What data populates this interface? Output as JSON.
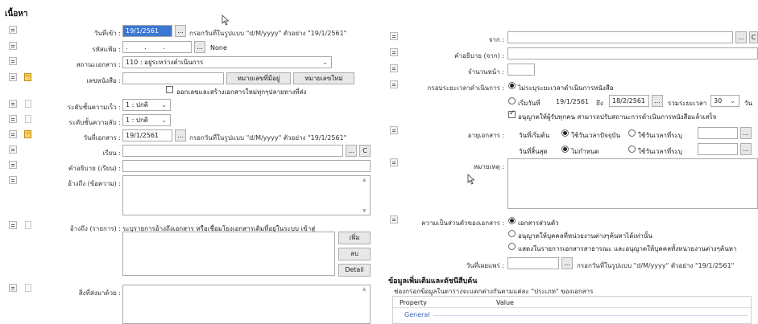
{
  "section_title": "เนื้อหา",
  "left": {
    "date_in": {
      "label": "วันที่เข้า :",
      "value": "19/1/2561",
      "hint": "กรอกวันที่ในรูปแบบ \"d/M/yyyy\" ตัวอย่าง \"19/1/2561\""
    },
    "file_code": {
      "label": "รหัสแฟ้ม :",
      "value": ". . .",
      "none_text": "None"
    },
    "doc_status": {
      "label": "สถานะเอกสาร :",
      "value": "110 : อยู่ระหว่างดำเนินการ"
    },
    "doc_number": {
      "label": "เลขหนังสือ :",
      "value": "",
      "btn_existing": "หมายเลขที่มีอยู่",
      "btn_new": "หมายเลขใหม่",
      "checkbox_label": "ออกเลขและสร้างเอกสารใหม่ทุกๆปลายทางที่ส่ง"
    },
    "urgency": {
      "label": "ระดับชั้นความเร็ว :",
      "value": "1 : ปกติ"
    },
    "secrecy": {
      "label": "ระดับชั้นความลับ :",
      "value": "1 : ปกติ"
    },
    "doc_date": {
      "label": "วันที่เอกสาร :",
      "value": "19/1/2561",
      "hint": "กรอกวันที่ในรูปแบบ \"d/M/yyyy\" ตัวอย่าง \"19/1/2561\""
    },
    "to": {
      "label": "เรียน :",
      "value": ""
    },
    "to_desc": {
      "label": "คำอธิบาย (เรียน) :",
      "value": ""
    },
    "ref_text": {
      "label": "อ้างถึง (ข้อความ) :",
      "value": ""
    },
    "ref_list": {
      "label": "อ้างถึง (รายการ) :",
      "description": "ระบุรายการอ้างถึงเอกสาร หรือเชื่อมโยงเอกสารเดิมที่อยู่ในระบบ เข้าสู่",
      "btn_add": "เพิ่ม",
      "btn_delete": "ลบ",
      "btn_detail": "Detail"
    },
    "attachments": {
      "label": "สิ่งที่ส่งมาด้วย :",
      "value": ""
    }
  },
  "right": {
    "from": {
      "label": "จาก :",
      "value": ""
    },
    "from_desc": {
      "label": "คำอธิบาย (จาก) :",
      "value": ""
    },
    "pages": {
      "label": "จำนวนหน้า :",
      "value": ""
    },
    "timeframe": {
      "label": "กรอบระยะเวลาดำเนินการ :",
      "opt_none": "ไม่ระบุระยะเวลาดำเนินการหนังสือ",
      "opt_start": "เริ่มวันที่",
      "start_value": "19/1/2561",
      "to_text": "ถึง",
      "end_value": "18/2/2561",
      "total_label": "รวมระยะเวลา",
      "days_value": "30",
      "days_unit": "วัน",
      "allow_label": "อนุญาตให้ผู้รับทุกคน สามารถปรับสถานะการดำเนินการหนังสือแล้วเสร็จ"
    },
    "retention": {
      "label": "อายุเอกสาร :",
      "start_label": "วันที่เริ่มต้น",
      "opt_current": "ใช้วันเวลาปัจจุบัน",
      "opt_specify": "ใช้วันเวลาที่ระบุ",
      "end_label": "วันที่สิ้นสุด",
      "opt_unspecified": "ไม่กำหนด",
      "opt_specify2": "ใช้วันเวลาที่ระบุ"
    },
    "remarks": {
      "label": "หมายเหตุ :",
      "value": ""
    },
    "privacy": {
      "label": "ความเป็นส่วนตัวของเอกสาร :",
      "opt_private": "เอกสารส่วนตัว",
      "opt_internal": "อนุญาตให้บุคคลที่หน่วยงานต่างๆค้นหาได้เท่านั้น",
      "opt_public": "แสดงในรายการเอกสารสาธารณะ และอนุญาตให้บุคคลทั้งหน่วยงานต่างๆค้นหา"
    },
    "publish_date": {
      "label": "วันที่เผยแพร่ :",
      "value": "",
      "hint": "กรอกวันที่ในรูปแบบ \"d/M/yyyy\" ตัวอย่าง \"19/1/2561\""
    }
  },
  "extra": {
    "title": "ข้อมูลเพิ่มเติมและดัชนีสืบค้น",
    "subtitle": "ช่องกรอกข้อมูลในตารางจะแตกต่างกันตามแต่ละ \"ประเภท\" ของเอกสาร",
    "col_property": "Property",
    "col_value": "Value",
    "group_general": "General"
  },
  "common": {
    "ellipsis": "...",
    "clear": "C"
  },
  "icons": [
    "menu-icon",
    "page-icon",
    "folder-icon",
    "chevron-down-icon",
    "radio",
    "checkbox",
    "mouse-cursor-icon"
  ]
}
